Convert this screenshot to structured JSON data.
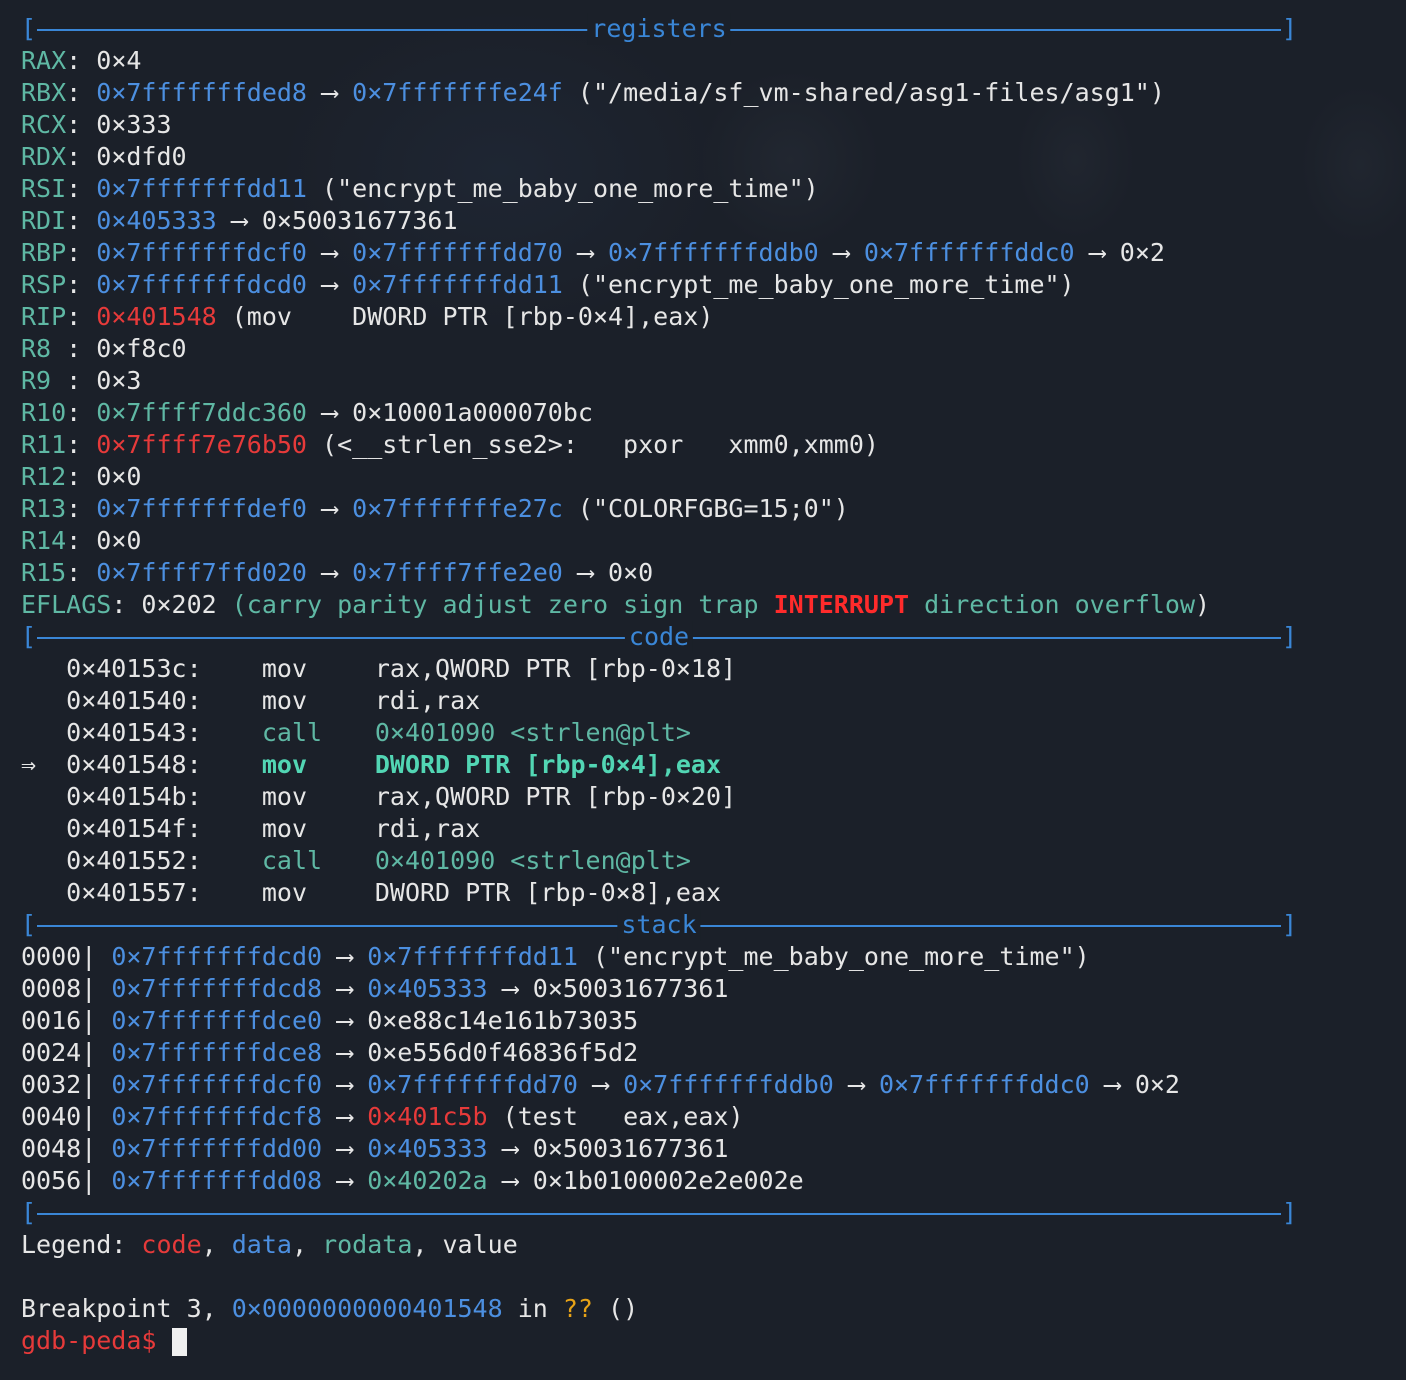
{
  "sections": {
    "registers": "registers",
    "code": "code",
    "stack": "stack"
  },
  "registers": [
    {
      "name": "RAX",
      "sep": ": ",
      "parts": [
        {
          "t": "0×4",
          "c": "white"
        }
      ]
    },
    {
      "name": "RBX",
      "sep": ": ",
      "parts": [
        {
          "t": "0×7fffffffded8",
          "c": "blue"
        },
        {
          "t": " ⟶ ",
          "c": "white"
        },
        {
          "t": "0×7fffffffe24f",
          "c": "blue"
        },
        {
          "t": " (\"/media/sf_vm-shared/asg1-files/asg1\")",
          "c": "white"
        }
      ]
    },
    {
      "name": "RCX",
      "sep": ": ",
      "parts": [
        {
          "t": "0×333",
          "c": "white"
        }
      ]
    },
    {
      "name": "RDX",
      "sep": ": ",
      "parts": [
        {
          "t": "0×dfd0",
          "c": "white"
        }
      ]
    },
    {
      "name": "RSI",
      "sep": ": ",
      "parts": [
        {
          "t": "0×7fffffffdd11",
          "c": "blue"
        },
        {
          "t": " (\"encrypt_me_baby_one_more_time\")",
          "c": "white"
        }
      ]
    },
    {
      "name": "RDI",
      "sep": ": ",
      "parts": [
        {
          "t": "0×405333",
          "c": "blue"
        },
        {
          "t": " ⟶ ",
          "c": "white"
        },
        {
          "t": "0×50031677361",
          "c": "white"
        }
      ]
    },
    {
      "name": "RBP",
      "sep": ": ",
      "parts": [
        {
          "t": "0×7fffffffdcf0",
          "c": "blue"
        },
        {
          "t": " ⟶ ",
          "c": "white"
        },
        {
          "t": "0×7fffffffdd70",
          "c": "blue"
        },
        {
          "t": " ⟶ ",
          "c": "white"
        },
        {
          "t": "0×7fffffffddb0",
          "c": "blue"
        },
        {
          "t": " ⟶ ",
          "c": "white"
        },
        {
          "t": "0×7fffffffddc0",
          "c": "blue"
        },
        {
          "t": " ⟶ ",
          "c": "white"
        },
        {
          "t": "0×2",
          "c": "white"
        }
      ]
    },
    {
      "name": "RSP",
      "sep": ": ",
      "parts": [
        {
          "t": "0×7fffffffdcd0",
          "c": "blue"
        },
        {
          "t": " ⟶ ",
          "c": "white"
        },
        {
          "t": "0×7fffffffdd11",
          "c": "blue"
        },
        {
          "t": " (\"encrypt_me_baby_one_more_time\")",
          "c": "white"
        }
      ]
    },
    {
      "name": "RIP",
      "sep": ": ",
      "parts": [
        {
          "t": "0×401548",
          "c": "red"
        },
        {
          "t": " (mov    DWORD PTR [rbp-0×4],eax)",
          "c": "white"
        }
      ]
    },
    {
      "name": "R8 ",
      "sep": ": ",
      "parts": [
        {
          "t": "0×f8c0",
          "c": "white"
        }
      ]
    },
    {
      "name": "R9 ",
      "sep": ": ",
      "parts": [
        {
          "t": "0×3",
          "c": "white"
        }
      ]
    },
    {
      "name": "R10",
      "sep": ": ",
      "parts": [
        {
          "t": "0×7ffff7ddc360",
          "c": "green"
        },
        {
          "t": " ⟶ ",
          "c": "white"
        },
        {
          "t": "0×10001a000070bc",
          "c": "white"
        }
      ]
    },
    {
      "name": "R11",
      "sep": ": ",
      "parts": [
        {
          "t": "0×7ffff7e76b50",
          "c": "red"
        },
        {
          "t": " (<__strlen_sse2>:   pxor   xmm0,xmm0)",
          "c": "white"
        }
      ]
    },
    {
      "name": "R12",
      "sep": ": ",
      "parts": [
        {
          "t": "0×0",
          "c": "white"
        }
      ]
    },
    {
      "name": "R13",
      "sep": ": ",
      "parts": [
        {
          "t": "0×7fffffffdef0",
          "c": "blue"
        },
        {
          "t": " ⟶ ",
          "c": "white"
        },
        {
          "t": "0×7fffffffe27c",
          "c": "blue"
        },
        {
          "t": " (\"COLORFGBG=15;0\")",
          "c": "white"
        }
      ]
    },
    {
      "name": "R14",
      "sep": ": ",
      "parts": [
        {
          "t": "0×0",
          "c": "white"
        }
      ]
    },
    {
      "name": "R15",
      "sep": ": ",
      "parts": [
        {
          "t": "0×7ffff7ffd020",
          "c": "blue"
        },
        {
          "t": " ⟶ ",
          "c": "white"
        },
        {
          "t": "0×7ffff7ffe2e0",
          "c": "blue"
        },
        {
          "t": " ⟶ ",
          "c": "white"
        },
        {
          "t": "0×0",
          "c": "white"
        }
      ]
    }
  ],
  "eflags": {
    "label": "EFLAGS",
    "value": ": 0×202 ",
    "flags": [
      {
        "t": "(carry parity adjust zero sign trap ",
        "c": "green"
      },
      {
        "t": "INTERRUPT",
        "c": "redb"
      },
      {
        "t": " direction overflow",
        "c": "green"
      },
      {
        "t": ")",
        "c": "white"
      }
    ]
  },
  "code": [
    {
      "prefix": "   ",
      "addr": "0×40153c:",
      "op": "mov",
      "args": "rax,QWORD PTR [rbp-0×18]",
      "cur": false,
      "call": false
    },
    {
      "prefix": "   ",
      "addr": "0×401540:",
      "op": "mov",
      "args": "rdi,rax",
      "cur": false,
      "call": false
    },
    {
      "prefix": "   ",
      "addr": "0×401543:",
      "op": "call",
      "args": "0×401090 <strlen@plt>",
      "cur": false,
      "call": true
    },
    {
      "prefix": "⇒  ",
      "addr": "0×401548:",
      "op": "mov",
      "args": "DWORD PTR [rbp-0×4],eax",
      "cur": true,
      "call": false
    },
    {
      "prefix": "   ",
      "addr": "0×40154b:",
      "op": "mov",
      "args": "rax,QWORD PTR [rbp-0×20]",
      "cur": false,
      "call": false
    },
    {
      "prefix": "   ",
      "addr": "0×40154f:",
      "op": "mov",
      "args": "rdi,rax",
      "cur": false,
      "call": false
    },
    {
      "prefix": "   ",
      "addr": "0×401552:",
      "op": "call",
      "args": "0×401090 <strlen@plt>",
      "cur": false,
      "call": true
    },
    {
      "prefix": "   ",
      "addr": "0×401557:",
      "op": "mov",
      "args": "DWORD PTR [rbp-0×8],eax",
      "cur": false,
      "call": false
    }
  ],
  "stack": [
    {
      "off": "0000",
      "parts": [
        {
          "t": "0×7fffffffdcd0",
          "c": "blue"
        },
        {
          "t": " ⟶ ",
          "c": "white"
        },
        {
          "t": "0×7fffffffdd11",
          "c": "blue"
        },
        {
          "t": " (\"encrypt_me_baby_one_more_time\")",
          "c": "white"
        }
      ]
    },
    {
      "off": "0008",
      "parts": [
        {
          "t": "0×7fffffffdcd8",
          "c": "blue"
        },
        {
          "t": " ⟶ ",
          "c": "white"
        },
        {
          "t": "0×405333",
          "c": "blue"
        },
        {
          "t": " ⟶ ",
          "c": "white"
        },
        {
          "t": "0×50031677361",
          "c": "white"
        }
      ]
    },
    {
      "off": "0016",
      "parts": [
        {
          "t": "0×7fffffffdce0",
          "c": "blue"
        },
        {
          "t": " ⟶ ",
          "c": "white"
        },
        {
          "t": "0×e88c14e161b73035",
          "c": "white"
        }
      ]
    },
    {
      "off": "0024",
      "parts": [
        {
          "t": "0×7fffffffdce8",
          "c": "blue"
        },
        {
          "t": " ⟶ ",
          "c": "white"
        },
        {
          "t": "0×e556d0f46836f5d2",
          "c": "white"
        }
      ]
    },
    {
      "off": "0032",
      "parts": [
        {
          "t": "0×7fffffffdcf0",
          "c": "blue"
        },
        {
          "t": " ⟶ ",
          "c": "white"
        },
        {
          "t": "0×7fffffffdd70",
          "c": "blue"
        },
        {
          "t": " ⟶ ",
          "c": "white"
        },
        {
          "t": "0×7fffffffddb0",
          "c": "blue"
        },
        {
          "t": " ⟶ ",
          "c": "white"
        },
        {
          "t": "0×7fffffffddc0",
          "c": "blue"
        },
        {
          "t": " ⟶ ",
          "c": "white"
        },
        {
          "t": "0×2",
          "c": "white"
        }
      ]
    },
    {
      "off": "0040",
      "parts": [
        {
          "t": "0×7fffffffdcf8",
          "c": "blue"
        },
        {
          "t": " ⟶ ",
          "c": "white"
        },
        {
          "t": "0×401c5b",
          "c": "red"
        },
        {
          "t": " (test   eax,eax)",
          "c": "white"
        }
      ]
    },
    {
      "off": "0048",
      "parts": [
        {
          "t": "0×7fffffffdd00",
          "c": "blue"
        },
        {
          "t": " ⟶ ",
          "c": "white"
        },
        {
          "t": "0×405333",
          "c": "blue"
        },
        {
          "t": " ⟶ ",
          "c": "white"
        },
        {
          "t": "0×50031677361",
          "c": "white"
        }
      ]
    },
    {
      "off": "0056",
      "parts": [
        {
          "t": "0×7fffffffdd08",
          "c": "blue"
        },
        {
          "t": " ⟶ ",
          "c": "white"
        },
        {
          "t": "0×40202a",
          "c": "green"
        },
        {
          "t": " ⟶ ",
          "c": "white"
        },
        {
          "t": "0×1b0100002e2e002e",
          "c": "white"
        }
      ]
    }
  ],
  "legend": {
    "label": "Legend: ",
    "items": [
      {
        "t": "code",
        "c": "red"
      },
      {
        "t": ", ",
        "c": "white"
      },
      {
        "t": "data",
        "c": "blue"
      },
      {
        "t": ", ",
        "c": "white"
      },
      {
        "t": "rodata",
        "c": "green"
      },
      {
        "t": ", ",
        "c": "white"
      },
      {
        "t": "value",
        "c": "white"
      }
    ]
  },
  "breakpoint": {
    "text1": "Breakpoint 3, ",
    "addr": "0×0000000000401548",
    "text2": " in ",
    "func": "??",
    "text3": " ()"
  },
  "prompt": {
    "text": "gdb-peda$ "
  },
  "colors": {
    "background": "#1b2029",
    "blue": "#4c8fe0",
    "green": "#5fb8a4",
    "red": "#e63a3a",
    "separator": "#3a86d6"
  }
}
